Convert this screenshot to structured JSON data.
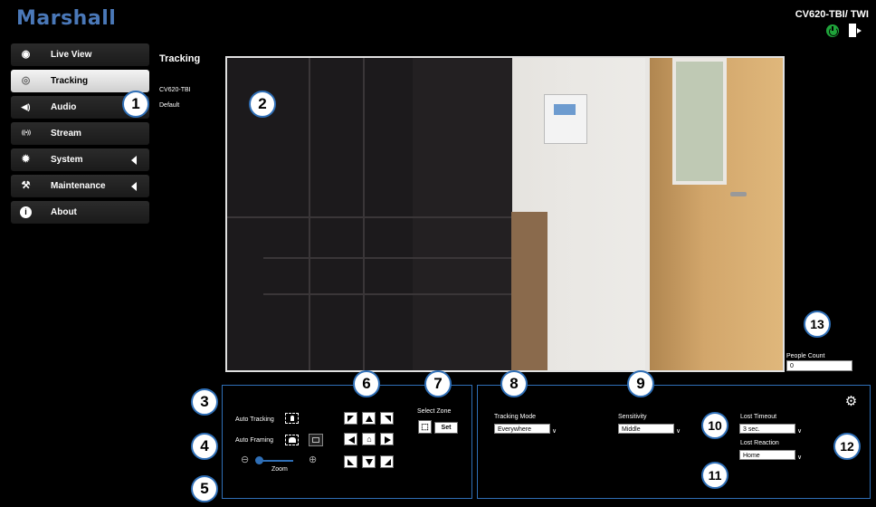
{
  "brand": {
    "logo": "Marshall",
    "model": "CV620-TBI/ TWI"
  },
  "sidebar": {
    "items": [
      {
        "label": "Live View",
        "icon": "eye-icon",
        "glyph": "◉"
      },
      {
        "label": "Tracking",
        "icon": "tracking-icon",
        "glyph": "◎"
      },
      {
        "label": "Audio",
        "icon": "speaker-icon",
        "glyph": "◀)"
      },
      {
        "label": "Stream",
        "icon": "stream-icon",
        "glyph": "((•))"
      },
      {
        "label": "System",
        "icon": "gear-icon",
        "glyph": "✹"
      },
      {
        "label": "Maintenance",
        "icon": "wrench-icon",
        "glyph": "⚒"
      },
      {
        "label": "About",
        "icon": "info-icon",
        "glyph": "i"
      }
    ]
  },
  "page": {
    "title": "Tracking",
    "device": "CV620-TBI",
    "preset": "Default"
  },
  "callouts": [
    "1",
    "2",
    "3",
    "4",
    "5",
    "6",
    "7",
    "8",
    "9",
    "10",
    "11",
    "12",
    "13"
  ],
  "people_count": {
    "label": "People Count",
    "value": "0"
  },
  "controls": {
    "auto_tracking": "Auto Tracking",
    "auto_framing": "Auto Framing",
    "zoom": "Zoom",
    "select_zone": "Select Zone",
    "set": "Set"
  },
  "settings": {
    "tracking_mode": {
      "label": "Tracking Mode",
      "value": "Everywhere"
    },
    "sensitivity": {
      "label": "Sensitivity",
      "value": "Middle"
    },
    "lost_timeout": {
      "label": "Lost Timeout",
      "value": "3 sec."
    },
    "lost_reaction": {
      "label": "Lost Reaction",
      "value": "Home"
    }
  },
  "colors": {
    "accent": "#2f6fb7",
    "brand": "#4a78b8",
    "power": "#1fa33a"
  }
}
